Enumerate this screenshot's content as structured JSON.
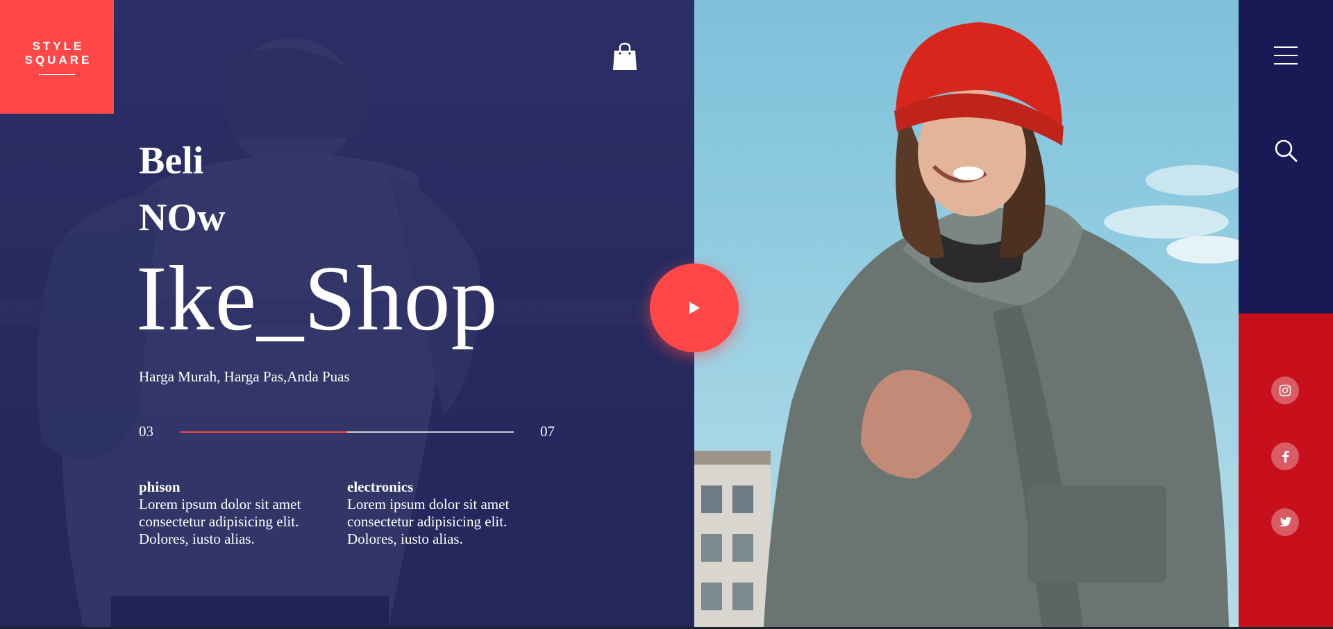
{
  "brand_logo": {
    "line1": "STYLE",
    "line2": "SQUARE"
  },
  "header": {
    "cart_icon": "shopping-bag-icon"
  },
  "hero": {
    "headline_line1": "Beli",
    "headline_line2": "NOw",
    "brand_name": "Ike_Shop",
    "tagline": "Harga Murah, Harga Pas,Anda Puas"
  },
  "slider": {
    "current": "03",
    "total": "07",
    "progress": 0.5
  },
  "info_columns": [
    {
      "title": "phison",
      "line1": "Lorem ipsum dolor sit amet",
      "line2": "consectetur adipisicing elit.",
      "line3": "Dolores, iusto alias."
    },
    {
      "title": "electronics",
      "line1": "Lorem ipsum dolor sit amet",
      "line2": "consectetur adipisicing elit.",
      "line3": "Dolores, iusto alias."
    }
  ],
  "play_button": {
    "icon": "play-icon"
  },
  "sidebar": {
    "menu_icon": "hamburger-menu-icon",
    "search_icon": "search-icon",
    "social": [
      {
        "icon": "instagram-icon"
      },
      {
        "icon": "facebook-icon"
      },
      {
        "icon": "twitter-icon"
      }
    ]
  },
  "colors": {
    "accent": "#ff4747",
    "panel_dark": "#262a5c",
    "sidebar_dark": "#171a54",
    "sidebar_red": "#c8101c"
  }
}
